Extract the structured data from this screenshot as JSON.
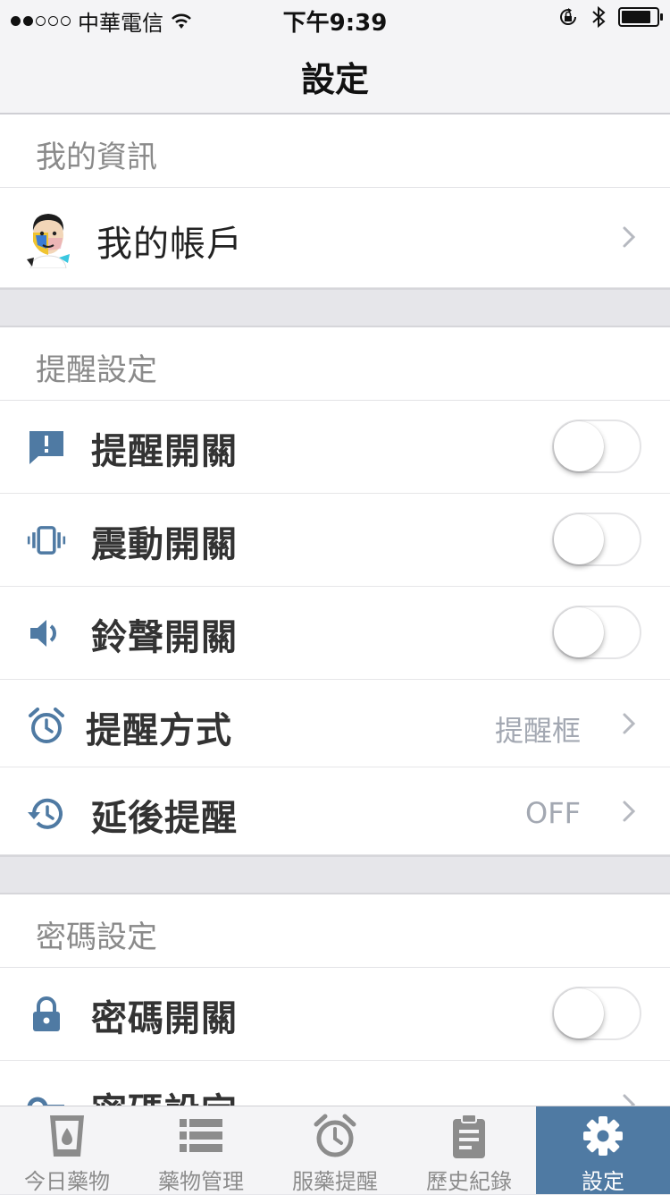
{
  "status_bar": {
    "carrier": "中華電信",
    "time": "下午9:39"
  },
  "nav": {
    "title": "設定"
  },
  "colors": {
    "accent": "#4f7aa3",
    "icon": "#4f7aa3",
    "muted": "#a3a8b2"
  },
  "sections": {
    "info": {
      "header": "我的資訊",
      "account_label": "我的帳戶"
    },
    "reminder": {
      "header": "提醒設定",
      "reminder_toggle": "提醒開關",
      "vibrate_toggle": "震動開關",
      "sound_toggle": "鈴聲開關",
      "reminder_mode": "提醒方式",
      "reminder_mode_value": "提醒框",
      "snooze": "延後提醒",
      "snooze_value": "OFF"
    },
    "password": {
      "header": "密碼設定",
      "password_toggle": "密碼開關",
      "password_setting": "密碼設定"
    }
  },
  "tabs": [
    {
      "label": "今日藥物",
      "icon": "cup-icon"
    },
    {
      "label": "藥物管理",
      "icon": "list-icon"
    },
    {
      "label": "服藥提醒",
      "icon": "alarm-clock-icon"
    },
    {
      "label": "歷史紀錄",
      "icon": "clipboard-icon"
    },
    {
      "label": "設定",
      "icon": "gear-icon"
    }
  ]
}
